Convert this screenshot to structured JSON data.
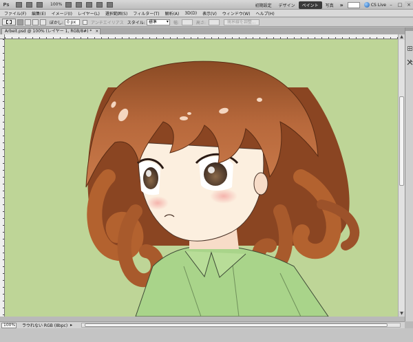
{
  "appbar": {
    "logo": "Ps",
    "zoom": "100%",
    "workspaces": [
      "初期設定",
      "デザイン",
      "ペイント",
      "写真"
    ],
    "active_workspace": "ペイント",
    "more": "»",
    "cs_live": "CS Live",
    "minimize": "–",
    "maximize": "□",
    "close": "×"
  },
  "menubar": {
    "items": [
      "ファイル(F)",
      "編集(E)",
      "イメージ(I)",
      "レイヤー(L)",
      "選択範囲(S)",
      "フィルター(T)",
      "解析(A)",
      "3D(D)",
      "表示(V)",
      "ウィンドウ(W)",
      "ヘルプ(H)"
    ]
  },
  "options": {
    "feather_label": "ぼかし:",
    "feather_value": "0 px",
    "antialias_label": "アンチエイリアス",
    "style_label": "スタイル:",
    "style_value": "標準",
    "width_label": "幅:",
    "height_label": "高さ:",
    "refine_button": "境界線を調整..."
  },
  "document": {
    "tab_title": "Arbeit.psd @ 100% (レイヤー 1, RGB/8#) *",
    "close": "×"
  },
  "status": {
    "zoom": "100%",
    "info": "ラウれない RGB (8bpc)",
    "arrow": "▸"
  },
  "scroll": {
    "up": "▲",
    "down": "▼"
  },
  "dock": {
    "icons": [
      "brush-presets-icon",
      "tools-icon"
    ]
  },
  "colors": {
    "canvas_bg": "#bed597",
    "hair": "#b9683c",
    "skin": "#fcefdf",
    "shirt": "#a9d48a"
  }
}
